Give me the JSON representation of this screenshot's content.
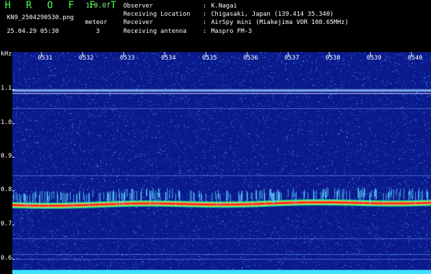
{
  "header": {
    "logo": "H R O F F T",
    "version": "1.0.0f",
    "filename": "KN9_2504290530.png",
    "meteor_label": "meteor",
    "meteor_count": "3",
    "timestamp": "25.04.29 05:30",
    "info": [
      {
        "key": "Observer",
        "value": "K.Nagai"
      },
      {
        "key": "Receiving Location",
        "value": "Chigasaki, Japan (139.414 35.340)"
      },
      {
        "key": "Receiver",
        "value": "AirSpy mini (Miakejima VOR 108.65MHz)"
      },
      {
        "key": "Receiving antenna",
        "value": "Maspro FM-3"
      }
    ]
  },
  "spectrogram": {
    "y_unit": "kHz",
    "y_ticks": [
      "1.1",
      "1.0",
      "0.9",
      "0.8",
      "0.7",
      "0.6"
    ],
    "x_ticks": [
      "0531",
      "0532",
      "0533",
      "0534",
      "0535",
      "0536",
      "0537",
      "0538",
      "0539",
      "0540"
    ],
    "colors": {
      "background": "#0a1a8c",
      "noise": "#3a8cff",
      "signal": "#ff2020",
      "line": "#ffffff"
    }
  }
}
